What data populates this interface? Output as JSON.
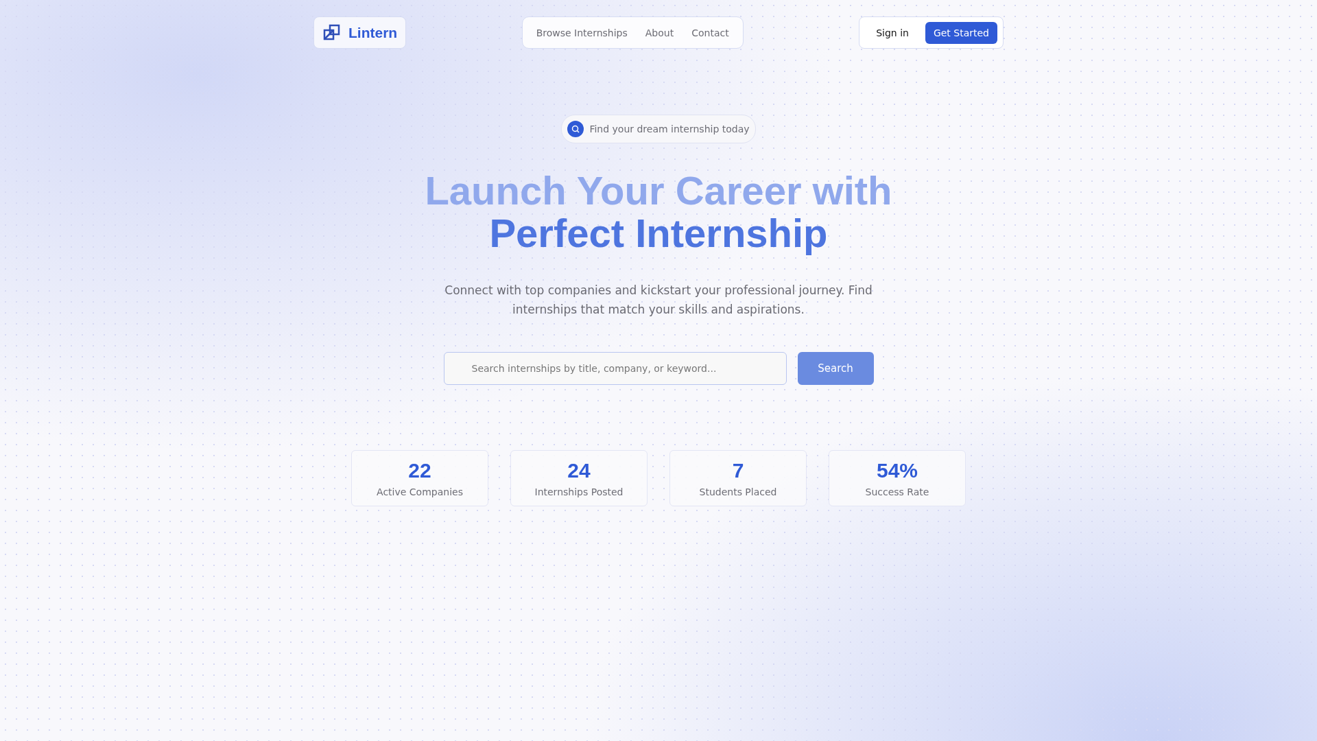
{
  "brand": {
    "name": "Lintern"
  },
  "nav": {
    "links": [
      {
        "label": "Browse Internships"
      },
      {
        "label": "About"
      },
      {
        "label": "Contact"
      }
    ]
  },
  "auth": {
    "sign_in": "Sign in",
    "get_started": "Get Started"
  },
  "hero": {
    "badge": "Find your dream internship today",
    "title_line_1": "Launch Your Career with",
    "title_line_2": "Perfect Internship",
    "subtitle": "Connect with top companies and kickstart your professional journey. Find internships that match your skills and aspirations."
  },
  "search": {
    "placeholder": "Search internships by title, company, or keyword...",
    "button": "Search"
  },
  "stats": [
    {
      "value": "22",
      "label": "Active Companies"
    },
    {
      "value": "24",
      "label": "Internships Posted"
    },
    {
      "value": "7",
      "label": "Students Placed"
    },
    {
      "value": "54%",
      "label": "Success Rate"
    }
  ]
}
